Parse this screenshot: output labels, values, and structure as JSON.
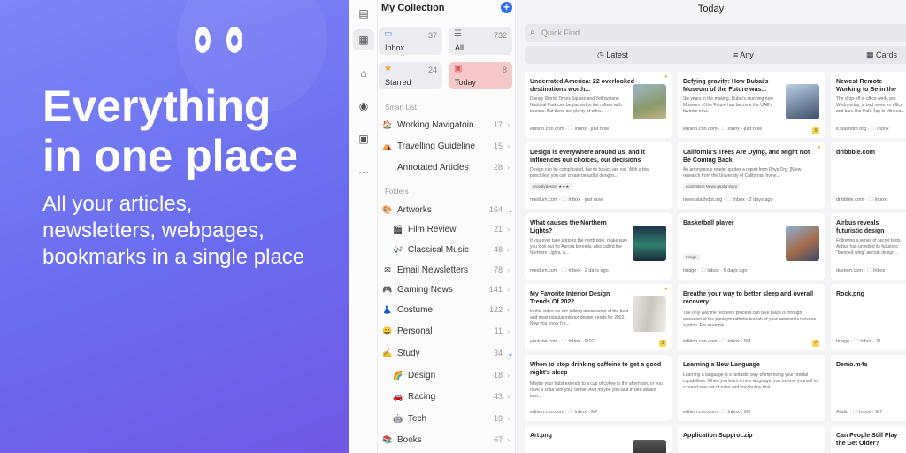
{
  "hero": {
    "headline": "Everything\nin one place",
    "subtitle": "All your articles,\nnewsletters, webpages,\nbookmarks in a single place"
  },
  "sidebar": {
    "title": "My Collection",
    "tiles": {
      "inbox": {
        "label": "Inbox",
        "count": "37"
      },
      "all": {
        "label": "All",
        "count": "732"
      },
      "starred": {
        "label": "Starred",
        "count": "24"
      },
      "today": {
        "label": "Today",
        "count": "8"
      }
    },
    "smart_list_label": "Smart List",
    "smart_list": [
      {
        "label": "Working Navigatoin",
        "count": "17",
        "icon": "🏠"
      },
      {
        "label": "Travelling Guideline",
        "count": "15",
        "icon": "⛺"
      },
      {
        "label": "Annotated Articles",
        "count": "28",
        "icon": ""
      }
    ],
    "folders_label": "Folders",
    "folders": [
      {
        "label": "Artworks",
        "count": "164",
        "icon": "🎨"
      },
      {
        "label": "Film Review",
        "count": "21",
        "icon": "🎬"
      },
      {
        "label": "Classical Music",
        "count": "48",
        "icon": "🎶"
      },
      {
        "label": "Email Newsletters",
        "count": "78",
        "icon": "✉"
      },
      {
        "label": "Gaming News",
        "count": "141",
        "icon": "🎮"
      },
      {
        "label": "Costume",
        "count": "122",
        "icon": "👗"
      },
      {
        "label": "Personal",
        "count": "11",
        "icon": "😀"
      },
      {
        "label": "Study",
        "count": "34",
        "icon": "✍"
      },
      {
        "label": "Design",
        "count": "18",
        "icon": "🌈"
      },
      {
        "label": "Racing",
        "count": "43",
        "icon": "🚗"
      },
      {
        "label": "Tech",
        "count": "19",
        "icon": "🤖"
      },
      {
        "label": "Books",
        "count": "67",
        "icon": "📚"
      }
    ]
  },
  "main": {
    "title": "Today",
    "search_placeholder": "Quick Find",
    "filters": {
      "latest": "Latest",
      "any": "Any",
      "cards": "Cards"
    }
  },
  "cards": [
    {
      "title": "Underrated America: 22 overlooked destinations worth...",
      "desc": "Disney World, Times Square and Yellowstone National Park can be packed to the rafters with tourists. But there are plenty of other...",
      "source": "edition.cnn.com · 🗀 Inbox · just now",
      "starred": true
    },
    {
      "title": "Defying gravity: How Dubai's Museum of the Future was...",
      "desc": "Six years in the making, Dubai's stunning new Museum of the Future has become the UAE's favorite new...",
      "source": "edition.cnn.com · 🗀 Inbox · just now",
      "badge": "9"
    },
    {
      "title": "Newest Remote Working to Be in the Office on Fri",
      "desc": "The drop-off in office work, par Wednesday, is bad news for office and bars like Pat's Tap in Minnea...",
      "source": "it.slashdot.org · 🗀 Inbox"
    },
    {
      "title": "Design is everywhere around us, and it influences our choices, our decisions",
      "desc": "Design can be complicated, but its basics are not. With a few principles, you can create beautiful designs...",
      "source": "medium.com · 🗀 Inbox · just now",
      "tags": "growth/design  ★★★"
    },
    {
      "title": "California's Trees Are Dying, and Might Not Be Coming Back",
      "desc": "An anonymous reader quotes a report from Phys.Org: [N]ew research from the University of California, Irvine...",
      "source": "news.slashdot.org · 🗀 Inbox · 2 days ago",
      "tags": "ecosystem   News report   story",
      "starred": true
    },
    {
      "title": "dribbble.com",
      "desc": "",
      "source": "dribbble.com · 🗀 Inbox"
    },
    {
      "title": "What causes the Northern Lights?",
      "desc": "If you ever take a trip to the north pole, make sure you look out for Aurora borealis, also called the Northern Lights, a...",
      "source": "medium.com · 🗀 Inbox · 2 days ago"
    },
    {
      "title": "Basketball player",
      "desc": "",
      "source": "Image · 🗀 Inbox · 6 days ago",
      "tags": "Image"
    },
    {
      "title": "Airbus reveals futuristic design",
      "desc": "Following a series of secret tests, Airbus has unveiled its futuristic \"blended wing\" aircraft design...",
      "source": "dezeen.com · 🗀 Inbox"
    },
    {
      "title": "My Favorite Interior Design Trends Of 2022",
      "desc": "In this video we are talking about some of the best and most popular interior design trends for 2022. Now you know I'm...",
      "source": "youtube.com · 🗀 Inbox · 9/10",
      "starred": true,
      "badge": "3"
    },
    {
      "title": "Breathe your way to better sleep and overall recovery",
      "desc": "The only way the recovery process can take place is through activation of the parasympathetic branch of your autonomic nervous system. For example...",
      "source": "edition.cnn.com · 🗀 Inbox · 9/8",
      "badge": "7"
    },
    {
      "title": "Rock.png",
      "desc": "",
      "source": "Image · 🗀 Inbox · 9/"
    },
    {
      "title": "When to stop drinking caffeine to get a good night's sleep",
      "desc": "Maybe your habit extends to a cup of coffee in the afternoon, or you have a soda with your dinner. And maybe you said in bed awake later...",
      "source": "edition.cnn.com · 🗀 Inbox · 9/7"
    },
    {
      "title": "Learning a New Language",
      "desc": "Learning a language is a fantastic way of improving your mental capabilities. When you learn a new language, you expose yourself to a brand new set of rules and vocabulary that...",
      "source": "edition.cnn.com · 🗀 Inbox · 9/6"
    },
    {
      "title": "Demo.m4a",
      "desc": "",
      "source": "Audio · 🗀 Inbox · 9/7"
    },
    {
      "title": "Art.png",
      "desc": "",
      "source": ""
    },
    {
      "title": "Application Supprot.zip",
      "desc": "",
      "source": ""
    },
    {
      "title": "Can People Still Play the Get Older?",
      "desc": "",
      "source": ""
    }
  ]
}
